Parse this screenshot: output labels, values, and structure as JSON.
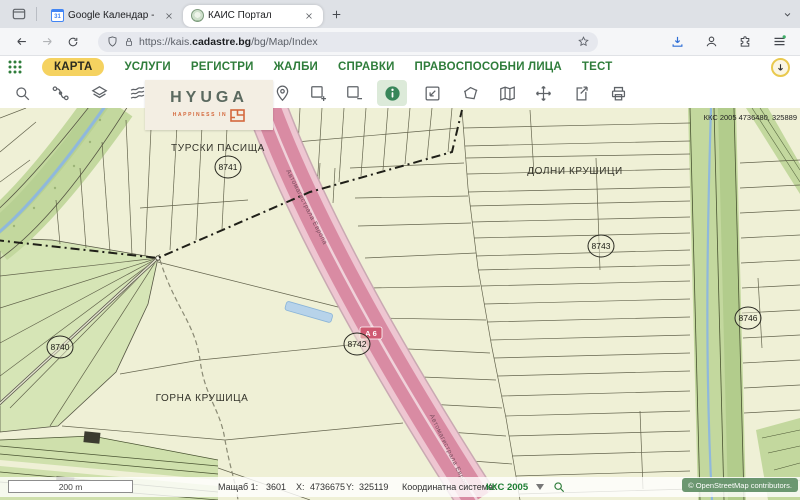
{
  "browser": {
    "tabs": [
      {
        "title": "Google Календар - Седмицата",
        "favicon_text": "31"
      },
      {
        "title": "КАИС Портал"
      }
    ],
    "url_prefix": "https://kais.",
    "url_domain": "cadastre.bg",
    "url_path": "/bg/Map/Index"
  },
  "nav": {
    "items": [
      {
        "label": "КАРТА"
      },
      {
        "label": "УСЛУГИ"
      },
      {
        "label": "РЕГИСТРИ"
      },
      {
        "label": "ЖАЛБИ"
      },
      {
        "label": "СПРАВКИ"
      },
      {
        "label": "ПРАВОСПОСОБНИ ЛИЦА"
      },
      {
        "label": "ТЕСТ"
      }
    ]
  },
  "ad": {
    "brand": "HYUGA",
    "tagline": "HAPPINESS IN"
  },
  "map": {
    "region_labels": {
      "turski_pasishta": "ТУРСКИ ПАСИЩА",
      "dolni_krushitsi": "ДОЛНИ КРУШИЦИ",
      "gorna_krushitsa": "ГОРНА КРУШИЦА"
    },
    "parcel_numbers": {
      "p8740": "8740",
      "p8741": "8741",
      "p8742": "8742",
      "p8743": "8743",
      "p8746": "8746"
    },
    "road": {
      "badge": "А 6",
      "name": "Автомагистрала Европа"
    },
    "coordinate_readout": "ККС 2005 4736480, 325889"
  },
  "statusbar": {
    "scalebar_label": "200 m",
    "scale_label": "Мащаб 1:",
    "scale_value": "3601",
    "x_label": "X:",
    "x_value": "4736675",
    "y_label": "Y:",
    "y_value": "325119",
    "crs_label": "Координатна система:",
    "crs_value": "ККС 2005",
    "attribution": "© OpenStreetMap contributors."
  },
  "colors": {
    "accent_green": "#2f7d3b",
    "active_pill_yellow": "#f5d260",
    "highway_pink": "#d98ba3",
    "crs_green": "#1e7e34"
  }
}
